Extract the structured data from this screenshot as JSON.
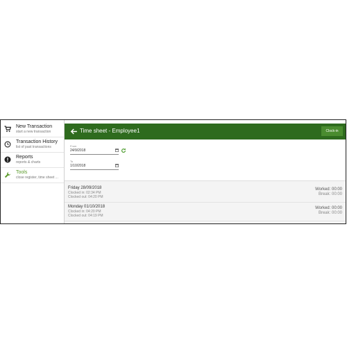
{
  "sidebar": {
    "items": [
      {
        "label": "New Transaction",
        "sub": "start a new transaction",
        "icon": "cart-icon"
      },
      {
        "label": "Transaction History",
        "sub": "list of past transactions",
        "icon": "history-icon"
      },
      {
        "label": "Reports",
        "sub": "reports & charts",
        "icon": "info-icon"
      },
      {
        "label": "Tools",
        "sub": "close register, time sheet ...",
        "icon": "wrench-icon",
        "active": true
      }
    ]
  },
  "header": {
    "title": "Time sheet - Employee1",
    "clockin_label": "Clock-in"
  },
  "filters": {
    "from_label": "From",
    "from_value": "24/9/2018",
    "to_label": "To",
    "to_value": "1/10/2018"
  },
  "entries": [
    {
      "date": "Friday 28/09/2018",
      "clocked_in": "Clocked in: 02:34 PM",
      "clocked_out": "Clocked out: 04:20 PM",
      "worked": "Worked: 00:00",
      "break": "Break: 00:00"
    },
    {
      "date": "Monday 01/10/2018",
      "clocked_in": "Clocked in: 04:20 PM",
      "clocked_out": "Clocked out: 04:19 PM",
      "worked": "Worked: 00:00",
      "break": "Break: 00:00"
    }
  ],
  "colors": {
    "appbar": "#2e6b1e",
    "accent": "#5a9a2a",
    "button": "#4a8c2f"
  }
}
